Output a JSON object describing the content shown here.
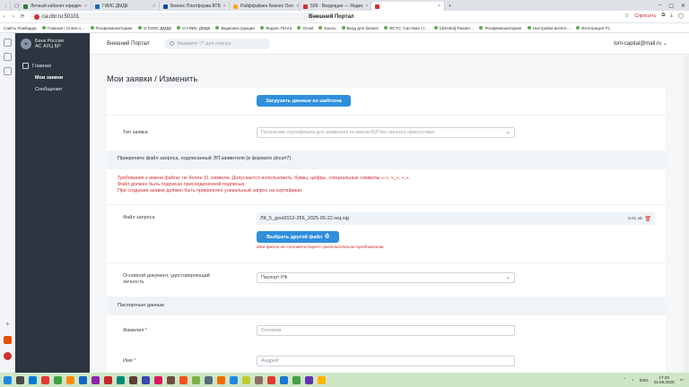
{
  "tabs": [
    {
      "label": "Личный кабинет юридич",
      "color": "#2e7d32"
    },
    {
      "label": "ГИИС ДМДК",
      "color": "#1565c0"
    },
    {
      "label": "Бизнес Платформа ВТБ",
      "color": "#0d47a1"
    },
    {
      "label": "Райффайзен Бизнес Онл",
      "color": "#f9a825"
    },
    {
      "label": "509 · Входящие — Яндек",
      "color": "#d32f2f"
    }
  ],
  "active_tab": {
    "label": "",
    "color": "#d32f2f"
  },
  "browser": {
    "url": "ca.cbr.ru:50101",
    "title": "Внешний Портал",
    "spros": "Спросить",
    "back": "‹",
    "forward": "›",
    "reload": "⟳"
  },
  "bookmarks": [
    "Сайты Ломбарда",
    "Главная | Сneta о…",
    "Росфинмониторинг",
    "О ГИИС ДМДК",
    "О ГИИС ДМДК",
    "Видеоинструкции",
    "Яндекс.Почта",
    "Gmail",
    "Кассы",
    "Вход для бизнес",
    "ФСТС: Система ст…",
    "[dclimbs] Pasam…",
    "Росфинмониторинг",
    "Настройка интеге…",
    "Интеграция ТС"
  ],
  "sidebar": {
    "logo_line1": "Банк России",
    "logo_line2": "АС АУЦ БР",
    "items": [
      {
        "label": "Главная"
      },
      {
        "label": "Мои заявки"
      },
      {
        "label": "Сообщения"
      }
    ]
  },
  "header": {
    "portal_name": "Внешний Портал",
    "search_placeholder": "Нажмите \"/\" для поиска",
    "user": "lom-capital@mail.ru"
  },
  "page": {
    "title": "Мои заявки / Изменить",
    "load_template_button": "Загрузить данные из шаблона",
    "request_type_label": "Тип заявки",
    "request_type_value": "Получение сертификата для заявителя от имени ЮЛ без личного присутствия",
    "attach_section": "Прикрепите файл запроса, подписанный ЭП заявителя (в формате pkcs#7)",
    "requirements": [
      "Требования к имени файла: не более 31 символа. Допускается использовать: буквы, цифры, специальные символы «-», «_», «.».",
      "Файл должен быть подписан присоединенной подписью.",
      "При создании заявки должен быть прикреплен уникальный запрос на сертификат"
    ],
    "file_label": "Файл запроса",
    "file_name": "ЛК_5_gost2012-256_2025-05-22.req.sig",
    "file_size": "6.81 кБ",
    "choose_other_button": "Выбрать другой файл",
    "file_error": "Имя файла не соответствует предъявленным требованиям.",
    "identity_doc_label_line1": "Основной документ, удостоверяющий",
    "identity_doc_label_line2": "личность",
    "identity_doc_value": "Паспорт РФ",
    "passport_section": "Паспортные данные",
    "surname_label": "Фамилия",
    "surname_value": "Солопов",
    "name_label": "Имя",
    "name_value": "Андрей",
    "required_mark": "*"
  },
  "tray": {
    "lang": "ENG",
    "time": "17:42",
    "date": "22.05.2025"
  },
  "colors": {
    "accent": "#2f8fdc",
    "sidebar_bg": "#2d3540",
    "error": "#d32f2f",
    "taskbar": "#cfe6c6"
  }
}
